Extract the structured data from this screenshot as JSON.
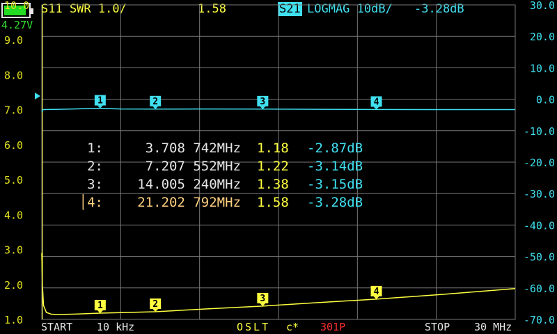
{
  "status": {
    "battery_voltage": "4.27V",
    "battery_level": 0.9
  },
  "trace1": {
    "label": "S11 SWR 1.0/",
    "value": "1.58",
    "color": "#ffff40"
  },
  "trace2": {
    "channel": "S21",
    "format": "LOGMAG 10dB/",
    "value": "-3.28dB",
    "color": "#40e0f0"
  },
  "left_axis": [
    "10.0",
    "9.0",
    "8.0",
    "7.0",
    "6.0",
    "5.0",
    "4.0",
    "3.0",
    "2.0",
    "1.0"
  ],
  "right_axis": [
    "30.0",
    "20.0",
    "10.0",
    "0.0",
    "-10.0",
    "-20.0",
    "-30.0",
    "-40.0",
    "-50.0",
    "-60.0",
    "-70.0"
  ],
  "markers": [
    {
      "id": "1:",
      "freq": "3.708 742MHz",
      "swr": "1.18",
      "gain": "-2.87dB"
    },
    {
      "id": "2:",
      "freq": "7.207 552MHz",
      "swr": "1.22",
      "gain": "-3.14dB"
    },
    {
      "id": "3:",
      "freq": "14.005 240MHz",
      "swr": "1.38",
      "gain": "-3.15dB"
    },
    {
      "id": "│4:",
      "freq": "21.202 792MHz",
      "swr": "1.58",
      "gain": "-3.28dB"
    }
  ],
  "footer": {
    "start_label": "START",
    "start_value": "10 kHz",
    "cal": "OSLT",
    "cal_flag": "c*",
    "points": "301P",
    "stop_label": "STOP",
    "stop_value": "30 MHz"
  },
  "chart_data": {
    "type": "line",
    "x_range_mhz": [
      0.01,
      30
    ],
    "series": [
      {
        "name": "S11 SWR",
        "axis": "left",
        "ylim": [
          1.0,
          10.0
        ],
        "x": [
          0.01,
          0.05,
          0.12,
          0.3,
          0.6,
          1.0,
          2.0,
          3.708,
          5.5,
          7.207,
          10.5,
          14.005,
          17.5,
          21.202,
          25.0,
          30.0
        ],
        "values": [
          2.9,
          2.0,
          1.4,
          1.2,
          1.15,
          1.14,
          1.15,
          1.18,
          1.2,
          1.22,
          1.3,
          1.38,
          1.48,
          1.58,
          1.7,
          1.88
        ]
      },
      {
        "name": "S21 LOGMAG",
        "axis": "right",
        "ylim": [
          -70,
          30
        ],
        "x": [
          0.01,
          0.1,
          1.0,
          2.0,
          3.708,
          5.0,
          7.207,
          10.0,
          14.005,
          18.0,
          21.202,
          25.0,
          30.0
        ],
        "values": [
          -4.0,
          -3.3,
          -3.2,
          -3.1,
          -2.87,
          -3.1,
          -3.14,
          -3.1,
          -3.15,
          -3.2,
          -3.28,
          -3.3,
          -3.3
        ]
      }
    ],
    "marker_freqs_mhz": [
      3.708742,
      7.207552,
      14.00524,
      21.202792
    ]
  }
}
